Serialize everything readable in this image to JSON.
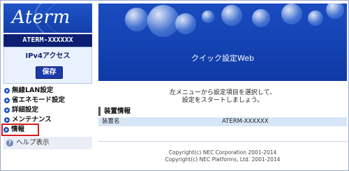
{
  "brand": {
    "logo_text": "Aterm"
  },
  "sidebar": {
    "model_name": "ATERM-XXXXXX",
    "mode_label": "IPv4アクセス",
    "save_label": "保存",
    "menu": [
      {
        "label": "無線LAN設定"
      },
      {
        "label": "省エネモード設定"
      },
      {
        "label": "詳細設定"
      },
      {
        "label": "メンテナンス"
      },
      {
        "label": "情報"
      }
    ],
    "help_label": "ヘルプ表示"
  },
  "main": {
    "banner_title": "クイック設定Web",
    "instruction_line1": "左メニューから設定項目を選択して、",
    "instruction_line2": "設定をスタートしましょう。",
    "section_title": "装置情報",
    "info_rows": [
      {
        "key": "装置名",
        "value": "ATERM-XXXXXX"
      }
    ],
    "copyright_line1": "Copyright(c) NEC Corporation 2001-2014",
    "copyright_line2": "Copyright(c) NEC Platforms, Ltd. 2001-2014"
  },
  "colors": {
    "brand_blue": "#1240a8",
    "model_bar": "#0c1f73",
    "active_outline": "#d81c1c"
  }
}
